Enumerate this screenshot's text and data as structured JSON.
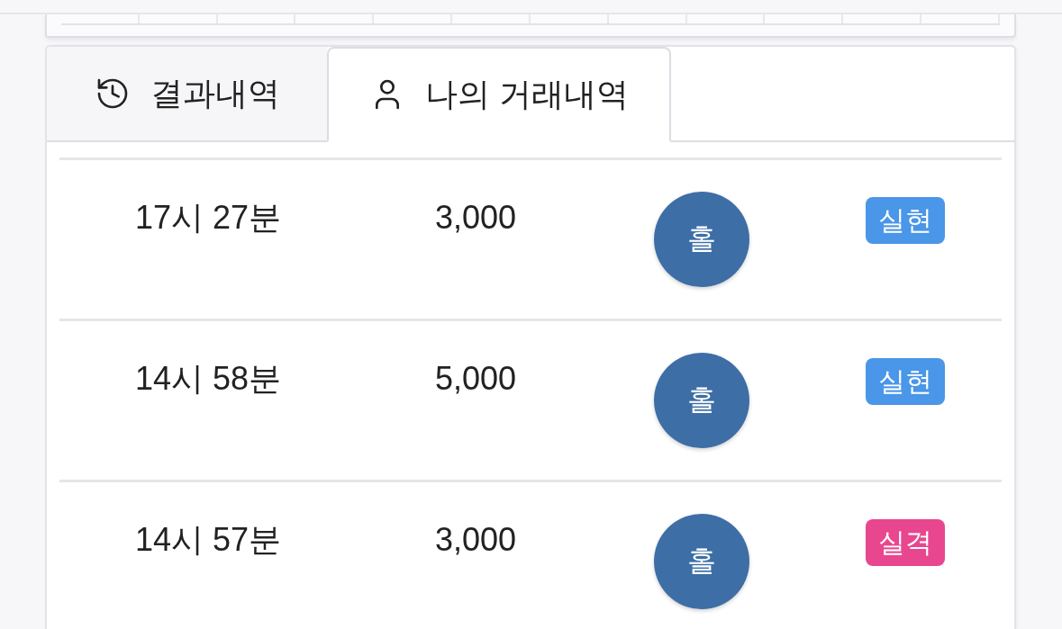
{
  "tabs": [
    {
      "label": "결과내역",
      "selected": false
    },
    {
      "label": "나의 거래내역",
      "selected": true
    }
  ],
  "trades": [
    {
      "time": "17시 27분",
      "amount": "3,000",
      "pick": "홀",
      "result": "실현",
      "color": "#4a96e8"
    },
    {
      "time": "14시 58분",
      "amount": "5,000",
      "pick": "홀",
      "result": "실현",
      "color": "#4a96e8"
    },
    {
      "time": "14시 57분",
      "amount": "3,000",
      "pick": "홀",
      "result": "실격",
      "color": "#e8478f"
    }
  ]
}
